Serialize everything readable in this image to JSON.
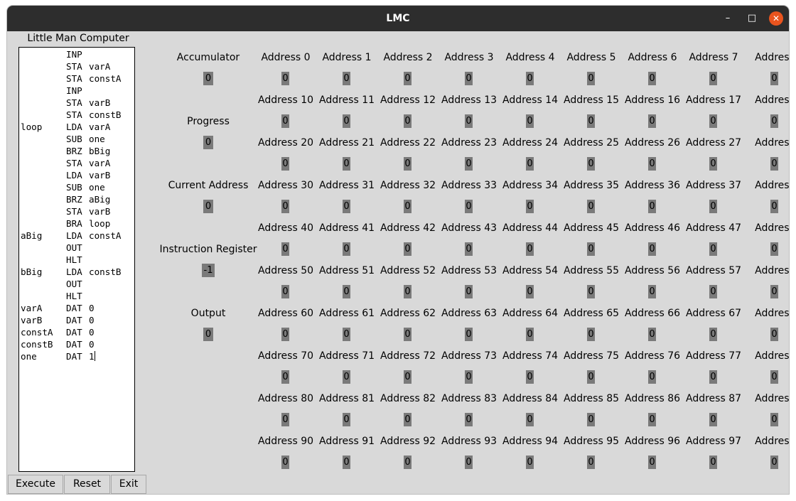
{
  "window": {
    "title": "LMC",
    "minimize_glyph": "–",
    "maximize_glyph": "□",
    "close_glyph": "✕"
  },
  "program": {
    "heading": "Little Man Computer",
    "lines": [
      {
        "label": "",
        "op": "INP",
        "arg": ""
      },
      {
        "label": "",
        "op": "STA",
        "arg": "varA"
      },
      {
        "label": "",
        "op": "STA",
        "arg": "constA"
      },
      {
        "label": "",
        "op": "INP",
        "arg": ""
      },
      {
        "label": "",
        "op": "STA",
        "arg": "varB"
      },
      {
        "label": "",
        "op": "STA",
        "arg": "constB"
      },
      {
        "label": "loop",
        "op": "LDA",
        "arg": "varA"
      },
      {
        "label": "",
        "op": "SUB",
        "arg": "one"
      },
      {
        "label": "",
        "op": "BRZ",
        "arg": "bBig"
      },
      {
        "label": "",
        "op": "STA",
        "arg": "varA"
      },
      {
        "label": "",
        "op": "LDA",
        "arg": "varB"
      },
      {
        "label": "",
        "op": "SUB",
        "arg": "one"
      },
      {
        "label": "",
        "op": "BRZ",
        "arg": "aBig"
      },
      {
        "label": "",
        "op": "STA",
        "arg": "varB"
      },
      {
        "label": "",
        "op": "BRA",
        "arg": "loop"
      },
      {
        "label": "aBig",
        "op": "LDA",
        "arg": "constA"
      },
      {
        "label": "",
        "op": "OUT",
        "arg": ""
      },
      {
        "label": "",
        "op": "HLT",
        "arg": ""
      },
      {
        "label": "bBig",
        "op": "LDA",
        "arg": "constB"
      },
      {
        "label": "",
        "op": "OUT",
        "arg": ""
      },
      {
        "label": "",
        "op": "HLT",
        "arg": ""
      },
      {
        "label": "varA",
        "op": "DAT",
        "arg": "0"
      },
      {
        "label": "varB",
        "op": "DAT",
        "arg": "0"
      },
      {
        "label": "constA",
        "op": "DAT",
        "arg": "0"
      },
      {
        "label": "constB",
        "op": "DAT",
        "arg": "0"
      },
      {
        "label": "one",
        "op": "DAT",
        "arg": "1"
      }
    ]
  },
  "buttons": {
    "execute": "Execute",
    "reset": "Reset",
    "exit": "Exit"
  },
  "registers": [
    {
      "label": "Accumulator",
      "value": "0"
    },
    {
      "label": "Progress",
      "value": "0"
    },
    {
      "label": "Current Address",
      "value": "0"
    },
    {
      "label": "Instruction Register",
      "value": "-1"
    },
    {
      "label": "Output",
      "value": "0"
    }
  ],
  "memory": {
    "rows": [
      [
        {
          "label": "Address 0",
          "value": "0"
        },
        {
          "label": "Address 1",
          "value": "0"
        },
        {
          "label": "Address 2",
          "value": "0"
        },
        {
          "label": "Address 3",
          "value": "0"
        },
        {
          "label": "Address 4",
          "value": "0"
        },
        {
          "label": "Address 5",
          "value": "0"
        },
        {
          "label": "Address 6",
          "value": "0"
        },
        {
          "label": "Address 7",
          "value": "0"
        },
        {
          "label": "Address",
          "value": "0"
        }
      ],
      [
        {
          "label": "Address 10",
          "value": "0"
        },
        {
          "label": "Address 11",
          "value": "0"
        },
        {
          "label": "Address 12",
          "value": "0"
        },
        {
          "label": "Address 13",
          "value": "0"
        },
        {
          "label": "Address 14",
          "value": "0"
        },
        {
          "label": "Address 15",
          "value": "0"
        },
        {
          "label": "Address 16",
          "value": "0"
        },
        {
          "label": "Address 17",
          "value": "0"
        },
        {
          "label": "Address",
          "value": "0"
        }
      ],
      [
        {
          "label": "Address 20",
          "value": "0"
        },
        {
          "label": "Address 21",
          "value": "0"
        },
        {
          "label": "Address 22",
          "value": "0"
        },
        {
          "label": "Address 23",
          "value": "0"
        },
        {
          "label": "Address 24",
          "value": "0"
        },
        {
          "label": "Address 25",
          "value": "0"
        },
        {
          "label": "Address 26",
          "value": "0"
        },
        {
          "label": "Address 27",
          "value": "0"
        },
        {
          "label": "Address",
          "value": "0"
        }
      ],
      [
        {
          "label": "Address 30",
          "value": "0"
        },
        {
          "label": "Address 31",
          "value": "0"
        },
        {
          "label": "Address 32",
          "value": "0"
        },
        {
          "label": "Address 33",
          "value": "0"
        },
        {
          "label": "Address 34",
          "value": "0"
        },
        {
          "label": "Address 35",
          "value": "0"
        },
        {
          "label": "Address 36",
          "value": "0"
        },
        {
          "label": "Address 37",
          "value": "0"
        },
        {
          "label": "Address",
          "value": "0"
        }
      ],
      [
        {
          "label": "Address 40",
          "value": "0"
        },
        {
          "label": "Address 41",
          "value": "0"
        },
        {
          "label": "Address 42",
          "value": "0"
        },
        {
          "label": "Address 43",
          "value": "0"
        },
        {
          "label": "Address 44",
          "value": "0"
        },
        {
          "label": "Address 45",
          "value": "0"
        },
        {
          "label": "Address 46",
          "value": "0"
        },
        {
          "label": "Address 47",
          "value": "0"
        },
        {
          "label": "Address",
          "value": "0"
        }
      ],
      [
        {
          "label": "Address 50",
          "value": "0"
        },
        {
          "label": "Address 51",
          "value": "0"
        },
        {
          "label": "Address 52",
          "value": "0"
        },
        {
          "label": "Address 53",
          "value": "0"
        },
        {
          "label": "Address 54",
          "value": "0"
        },
        {
          "label": "Address 55",
          "value": "0"
        },
        {
          "label": "Address 56",
          "value": "0"
        },
        {
          "label": "Address 57",
          "value": "0"
        },
        {
          "label": "Address",
          "value": "0"
        }
      ],
      [
        {
          "label": "Address 60",
          "value": "0"
        },
        {
          "label": "Address 61",
          "value": "0"
        },
        {
          "label": "Address 62",
          "value": "0"
        },
        {
          "label": "Address 63",
          "value": "0"
        },
        {
          "label": "Address 64",
          "value": "0"
        },
        {
          "label": "Address 65",
          "value": "0"
        },
        {
          "label": "Address 66",
          "value": "0"
        },
        {
          "label": "Address 67",
          "value": "0"
        },
        {
          "label": "Address",
          "value": "0"
        }
      ],
      [
        {
          "label": "Address 70",
          "value": "0"
        },
        {
          "label": "Address 71",
          "value": "0"
        },
        {
          "label": "Address 72",
          "value": "0"
        },
        {
          "label": "Address 73",
          "value": "0"
        },
        {
          "label": "Address 74",
          "value": "0"
        },
        {
          "label": "Address 75",
          "value": "0"
        },
        {
          "label": "Address 76",
          "value": "0"
        },
        {
          "label": "Address 77",
          "value": "0"
        },
        {
          "label": "Address",
          "value": "0"
        }
      ],
      [
        {
          "label": "Address 80",
          "value": "0"
        },
        {
          "label": "Address 81",
          "value": "0"
        },
        {
          "label": "Address 82",
          "value": "0"
        },
        {
          "label": "Address 83",
          "value": "0"
        },
        {
          "label": "Address 84",
          "value": "0"
        },
        {
          "label": "Address 85",
          "value": "0"
        },
        {
          "label": "Address 86",
          "value": "0"
        },
        {
          "label": "Address 87",
          "value": "0"
        },
        {
          "label": "Address",
          "value": "0"
        }
      ],
      [
        {
          "label": "Address 90",
          "value": "0"
        },
        {
          "label": "Address 91",
          "value": "0"
        },
        {
          "label": "Address 92",
          "value": "0"
        },
        {
          "label": "Address 93",
          "value": "0"
        },
        {
          "label": "Address 94",
          "value": "0"
        },
        {
          "label": "Address 95",
          "value": "0"
        },
        {
          "label": "Address 96",
          "value": "0"
        },
        {
          "label": "Address 97",
          "value": "0"
        },
        {
          "label": "Address",
          "value": "0"
        }
      ]
    ]
  }
}
